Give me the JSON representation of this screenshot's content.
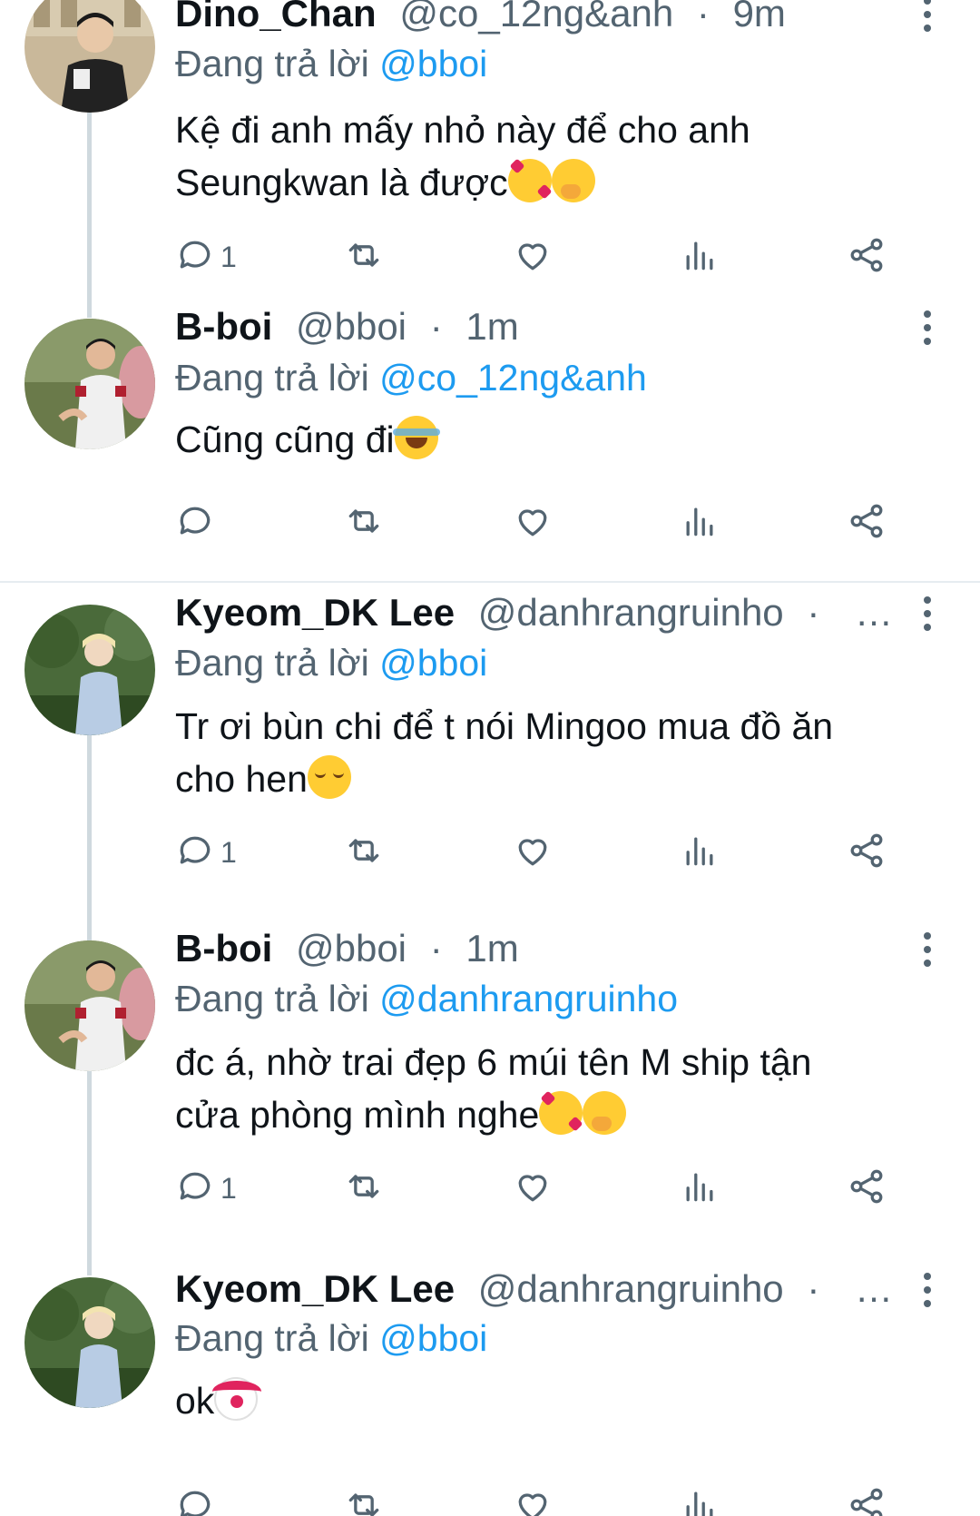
{
  "ui": {
    "reply_prefix": "Đang trả lời",
    "dot": "·"
  },
  "tweets": [
    {
      "name": "Dino_Chan",
      "handle": "@co_12ng&anh",
      "time": "9m",
      "reply_to": "@bboi",
      "lines": [
        "Kệ đi anh mấy nhỏ này để cho anh",
        "Seungkwan là được"
      ],
      "emojis": [
        "smiling-face-with-hearts",
        "face-with-hand-over-mouth"
      ],
      "reply_count": "1"
    },
    {
      "name": "B-boi",
      "handle": "@bboi",
      "time": "1m",
      "reply_to": "@co_12ng&anh",
      "lines": [
        "Cũng cũng đi"
      ],
      "emojis": [
        "face-with-tears-of-joy"
      ],
      "reply_count": ""
    },
    {
      "name": "Kyeom_DK Lee",
      "handle": "@danhrangruinho",
      "time": "…",
      "reply_to": "@bboi",
      "lines": [
        "Tr ơi bùn chi để t nói Mingoo mua đồ ăn",
        "cho hen"
      ],
      "emojis": [
        "relieved-face"
      ],
      "reply_count": "1"
    },
    {
      "name": "B-boi",
      "handle": "@bboi",
      "time": "1m",
      "reply_to": "@danhrangruinho",
      "lines": [
        "đc á, nhờ trai đẹp 6 múi tên M ship tận",
        "cửa phòng mình nghe"
      ],
      "emojis": [
        "smiling-face-with-hearts",
        "face-with-hand-over-mouth"
      ],
      "reply_count": "1"
    },
    {
      "name": "Kyeom_DK Lee",
      "handle": "@danhrangruinho",
      "time": "…",
      "reply_to": "@bboi",
      "lines": [
        "ok"
      ],
      "emojis": [
        "clown-face"
      ],
      "reply_count": ""
    }
  ],
  "colors": {
    "link": "#1d9bf0",
    "secondary": "#536471",
    "thread_line": "#cfd9de",
    "divider": "#e6ecf0"
  },
  "icons": [
    "reply-icon",
    "retweet-icon",
    "like-icon",
    "views-icon",
    "share-icon",
    "more-options-icon"
  ]
}
